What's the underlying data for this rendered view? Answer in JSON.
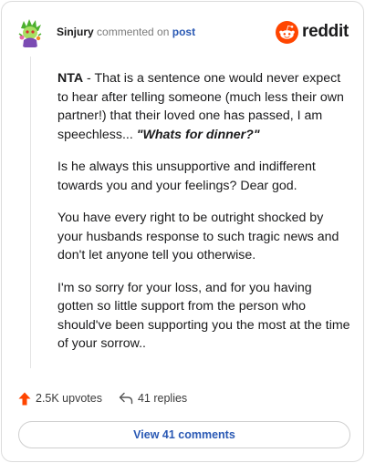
{
  "header": {
    "username": "Sinjury",
    "action_text": "commented on",
    "post_link": "post",
    "brand": "reddit"
  },
  "comment": {
    "paragraphs": [
      {
        "lead": "NTA",
        "text": " - That is a sentence one would never expect to hear after telling someone (much less their own partner!) that their loved one has passed, I am speechless... ",
        "quote": "\"Whats for dinner?\""
      },
      {
        "text": "Is he always this unsupportive and indifferent towards you and your feelings? Dear god."
      },
      {
        "text": "You have every right to be outright shocked by your husbands response to such tragic news and don't let anyone tell you otherwise."
      },
      {
        "text": "I'm so sorry for your loss, and for you having gotten so little support from the person who should've been supporting you the most at the time of your sorrow.."
      }
    ]
  },
  "actions": {
    "upvotes": "2.5K upvotes",
    "replies": "41 replies"
  },
  "footer": {
    "view_button": "View 41 comments"
  },
  "colors": {
    "brand_orange": "#ff4500",
    "link_blue": "#2a59b4",
    "upvote_orange": "#ff4500"
  },
  "icons": [
    "avatar-snoo-icon",
    "reddit-snoo-icon",
    "upvote-arrow-icon",
    "reply-arrow-icon"
  ]
}
